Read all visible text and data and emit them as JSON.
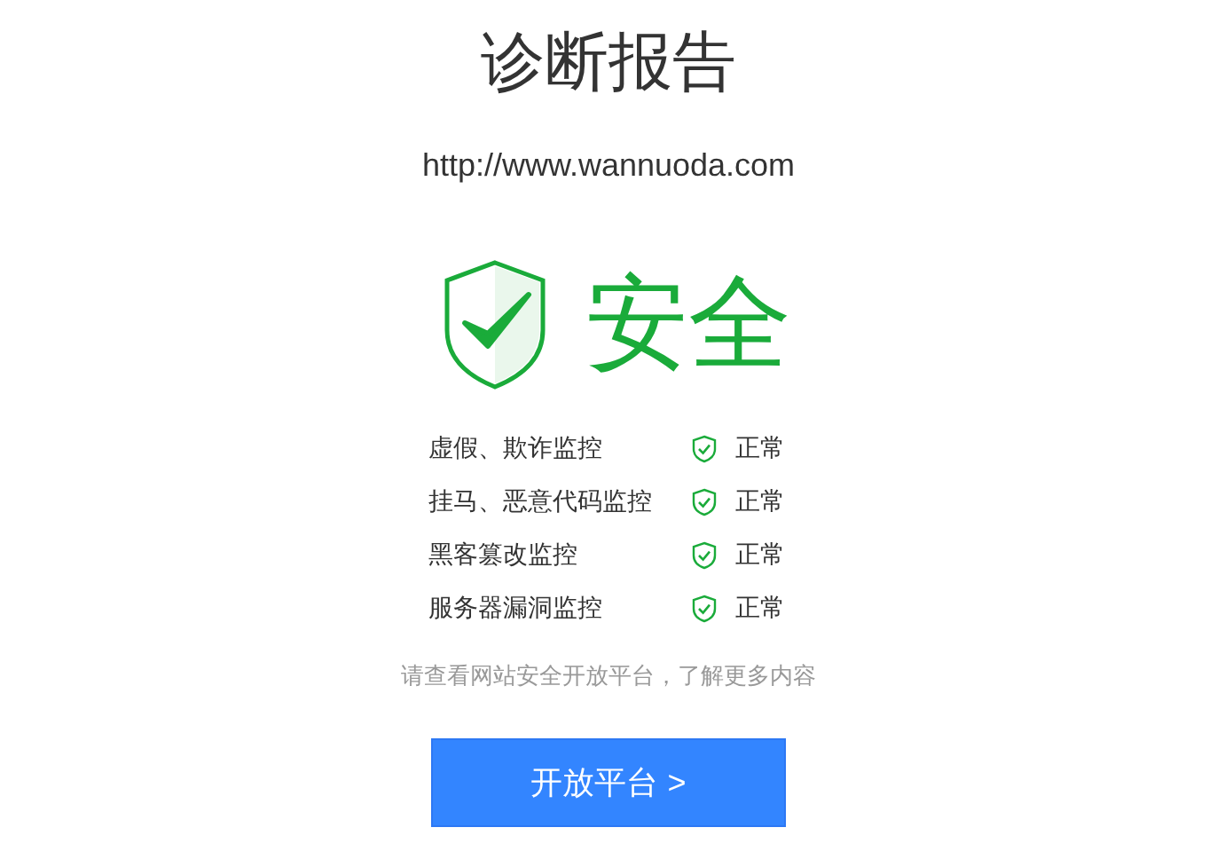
{
  "title": "诊断报告",
  "url": "http://www.wannuoda.com",
  "verdict": {
    "label": "安全",
    "safe": true
  },
  "checks": [
    {
      "label": "虚假、欺诈监控",
      "status": "正常",
      "ok": true
    },
    {
      "label": "挂马、恶意代码监控",
      "status": "正常",
      "ok": true
    },
    {
      "label": "黑客篡改监控",
      "status": "正常",
      "ok": true
    },
    {
      "label": "服务器漏洞监控",
      "status": "正常",
      "ok": true
    }
  ],
  "note": "请查看网站安全开放平台，了解更多内容",
  "button": {
    "label": "开放平台 >"
  }
}
